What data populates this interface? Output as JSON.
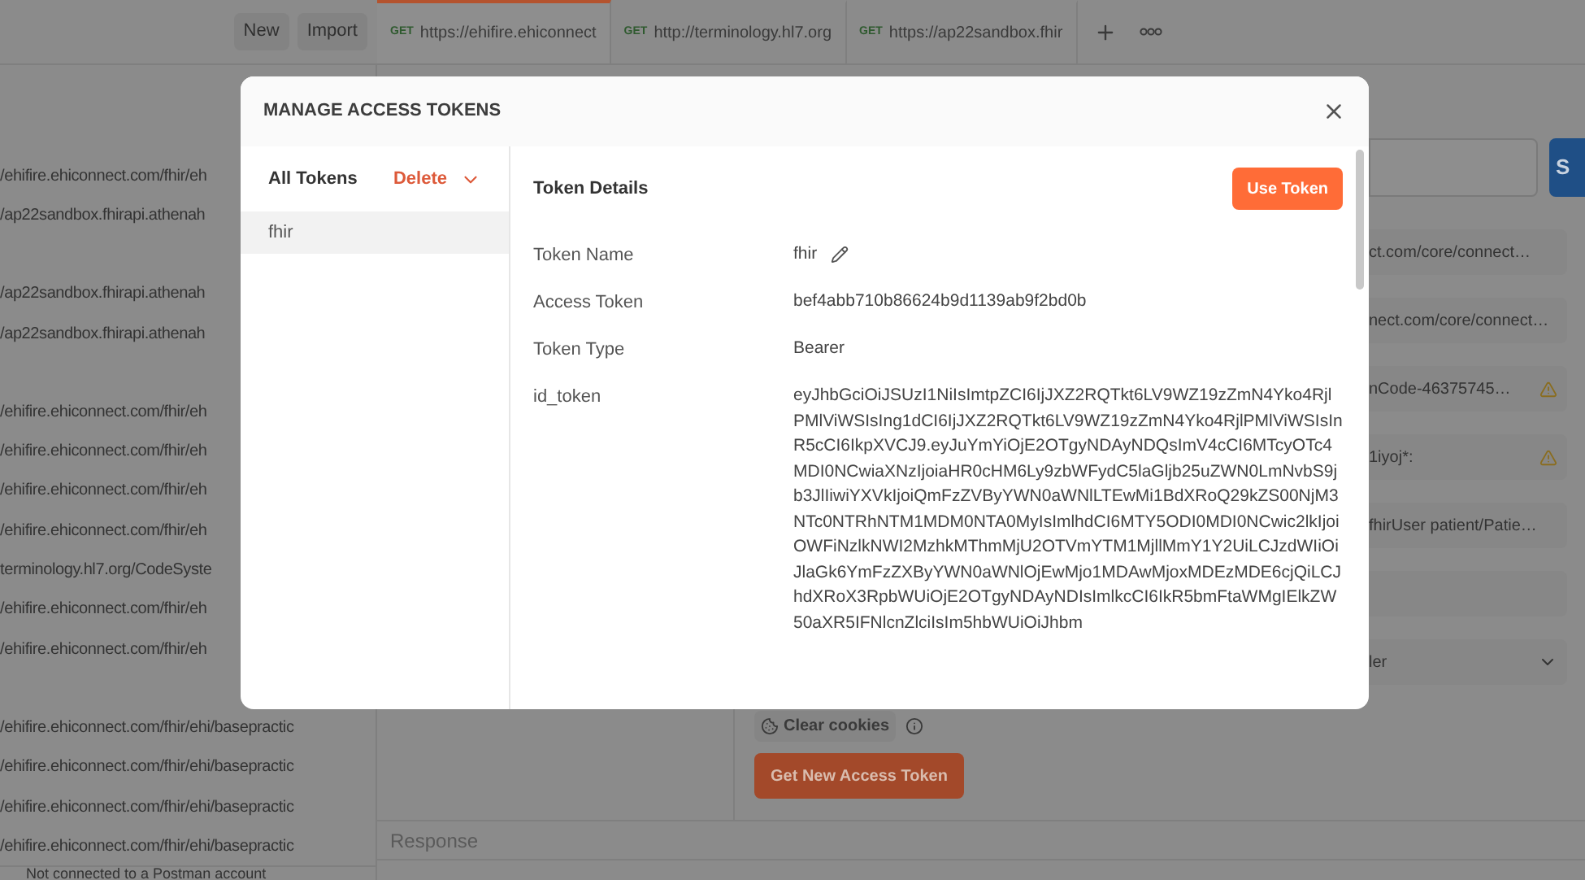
{
  "app": {
    "toolbar_buttons": [
      "New",
      "Import"
    ],
    "tabs": [
      {
        "method": "GET",
        "url": "https://ehifire.ehiconnect",
        "selected": true
      },
      {
        "method": "GET",
        "url": "http://terminology.hl7.org",
        "selected": false
      },
      {
        "method": "GET",
        "url": "https://ap22sandbox.fhir",
        "selected": false
      }
    ]
  },
  "sidebar": {
    "groups": [
      {
        "items": [
          "/ehifire.ehiconnect.com/fhir/eh",
          "/ap22sandbox.fhirapi.athenah"
        ]
      },
      {
        "items": [
          "/ap22sandbox.fhirapi.athenah",
          "/ap22sandbox.fhirapi.athenah"
        ]
      },
      {
        "items": [
          "/ehifire.ehiconnect.com/fhir/eh",
          "/ehifire.ehiconnect.com/fhir/eh",
          "/ehifire.ehiconnect.com/fhir/eh",
          "/ehifire.ehiconnect.com/fhir/eh",
          "terminology.hl7.org/CodeSyste",
          "/ehifire.ehiconnect.com/fhir/eh",
          "/ehifire.ehiconnect.com/fhir/eh"
        ]
      },
      {
        "items": [
          "/ehifire.ehiconnect.com/fhir/ehi/basepractic",
          "/ehifire.ehiconnect.com/fhir/ehi/basepractic",
          "/ehifire.ehiconnect.com/fhir/ehi/basepractic",
          "/ehifire.ehiconnect.com/fhir/ehi/basepractic"
        ]
      }
    ],
    "status_bar": "Not connected to a Postman account"
  },
  "request": {
    "send_button": "S",
    "fields": [
      {
        "kind": "text",
        "value": "ct.com/core/connect…",
        "warning": false
      },
      {
        "kind": "text",
        "value": "nect.com/core/connect…",
        "warning": false
      },
      {
        "kind": "text",
        "value": "nCode-46375745…",
        "warning": true
      },
      {
        "kind": "text",
        "value": "1iyoj*:",
        "warning": true
      },
      {
        "kind": "text",
        "value": "fhirUser patient/Patie…",
        "warning": false
      },
      {
        "kind": "text",
        "warning": false
      },
      {
        "kind": "select",
        "value": "ler",
        "warning": false
      }
    ],
    "clear_cookies": "Clear cookies",
    "get_token_button": "Get New Access Token",
    "response_label": "Response"
  },
  "modal": {
    "title": "MANAGE ACCESS TOKENS",
    "filter": "All Tokens",
    "delete": "Delete",
    "tokens": [
      {
        "name": "fhir",
        "selected": true
      }
    ],
    "details_title": "Token Details",
    "use_button": "Use Token",
    "rows": [
      {
        "label": "Token Name",
        "value": "fhir",
        "editable": true
      },
      {
        "label": "Access Token",
        "value": "bef4abb710b86624b9d1139ab9f2bd0b",
        "editable": false
      },
      {
        "label": "Token Type",
        "value": "Bearer",
        "editable": false
      },
      {
        "label": "id_token",
        "value": "eyJhbGciOiJSUzI1NiIsImtpZCI6IjJXZ2RQTkt6LV9WZ19zZmN4Yko4RjlPMlViWSIsIng1dCI6IjJXZ2RQTkt6LV9WZ19zZmN4Yko4RjlPMlViWSIsInR5cCI6IkpXVCJ9.eyJuYmYiOjE2OTgyNDAyNDQsImV4cCI6MTcyOTc4MDI0NCwiaXNzIjoiaHR0cHM6Ly9zbWFydC5laGljb25uZWN0LmNvbS9jb3JlIiwiYXVkIjoiQmFzZVByYWN0aWNlLTEwMi1BdXRoQ29kZS00NjM3NTc0NTRhNTM1MDM0NTA0MyIsImlhdCI6MTY5ODI0MDI0NCwic2lkIjoiOWFiNzlkNWI2MzhkMThmMjU2OTVmYTM1MjllMmY1Y2UiLCJzdWIiOiJlaGk6YmFzZXByYWN0aWNlOjEwMjo1MDAwMjoxMDEzMDE6cjQiLCJhdXRoX3RpbWUiOjE2OTgyNDAyNDIsImlkcCI6IkR5bmFtaWMgIElkZW50aXR5IFNlcnZlciIsIm5hbWUiOiJhbm",
        "editable": false
      }
    ]
  }
}
